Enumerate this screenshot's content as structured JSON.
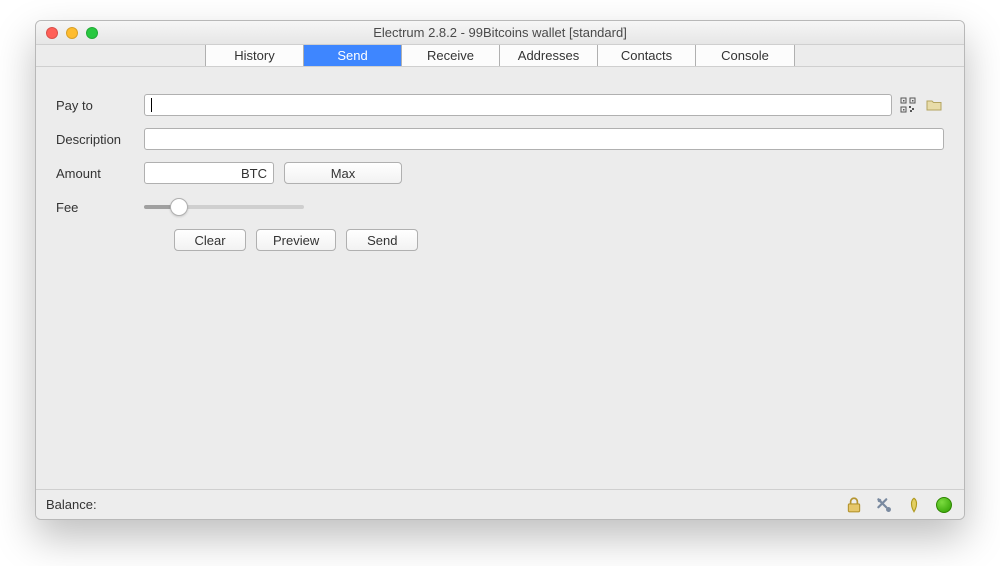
{
  "window": {
    "title": "Electrum 2.8.2  -  99Bitcoins wallet  [standard]"
  },
  "tabs": [
    {
      "label": "History",
      "active": false
    },
    {
      "label": "Send",
      "active": true
    },
    {
      "label": "Receive",
      "active": false
    },
    {
      "label": "Addresses",
      "active": false
    },
    {
      "label": "Contacts",
      "active": false
    },
    {
      "label": "Console",
      "active": false
    }
  ],
  "form": {
    "payto_label": "Pay to",
    "payto_value": "",
    "description_label": "Description",
    "description_value": "",
    "amount_label": "Amount",
    "amount_value": "",
    "amount_unit": "BTC",
    "max_button": "Max",
    "fee_label": "Fee",
    "fee_slider_value": 25
  },
  "actions": {
    "clear": "Clear",
    "preview": "Preview",
    "send": "Send"
  },
  "statusbar": {
    "balance_label": "Balance:",
    "balance_value": ""
  }
}
